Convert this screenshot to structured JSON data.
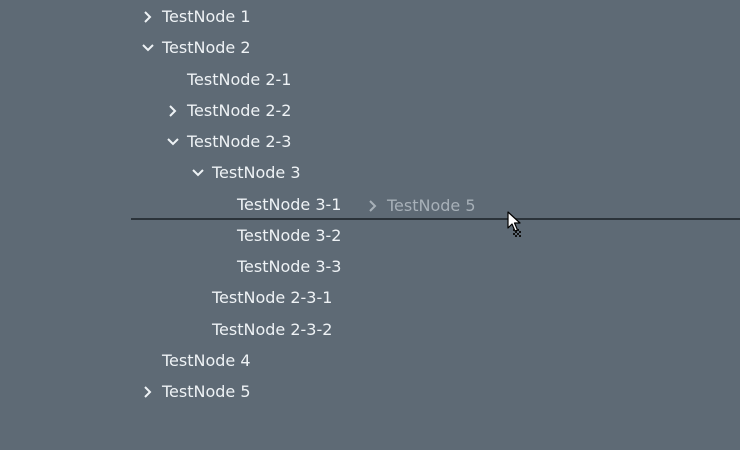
{
  "tree": {
    "nodes": [
      {
        "id": "n1",
        "label": "TestNode 1",
        "level": 0,
        "expander": "chevron-right-icon"
      },
      {
        "id": "n2",
        "label": "TestNode 2",
        "level": 0,
        "expander": "chevron-down-icon"
      },
      {
        "id": "n2-1",
        "label": "TestNode 2-1",
        "level": 1,
        "expander": null
      },
      {
        "id": "n2-2",
        "label": "TestNode 2-2",
        "level": 1,
        "expander": "chevron-right-icon"
      },
      {
        "id": "n2-3",
        "label": "TestNode 2-3",
        "level": 1,
        "expander": "chevron-down-icon"
      },
      {
        "id": "n3",
        "label": "TestNode 3",
        "level": 2,
        "expander": "chevron-down-icon"
      },
      {
        "id": "n3-1",
        "label": "TestNode 3-1",
        "level": 3,
        "expander": null
      },
      {
        "id": "n3-2",
        "label": "TestNode 3-2",
        "level": 3,
        "expander": null
      },
      {
        "id": "n3-3",
        "label": "TestNode 3-3",
        "level": 3,
        "expander": null
      },
      {
        "id": "n2-3-1",
        "label": "TestNode 2-3-1",
        "level": 2,
        "expander": null
      },
      {
        "id": "n2-3-2",
        "label": "TestNode 2-3-2",
        "level": 2,
        "expander": null
      },
      {
        "id": "n4",
        "label": "TestNode 4",
        "level": 0,
        "expander": null
      },
      {
        "id": "n5",
        "label": "TestNode 5",
        "level": 0,
        "expander": "chevron-right-icon"
      }
    ]
  },
  "drag": {
    "ghost_label": "TestNode 5",
    "ghost_icon": "chevron-right-icon",
    "cursor_icon": "drag-cursor-icon"
  },
  "colors": {
    "background": "#5e6a75",
    "text": "#eef2f5",
    "ghost_text": "#a7b0b8",
    "drop_indicator": "#2b333a"
  }
}
